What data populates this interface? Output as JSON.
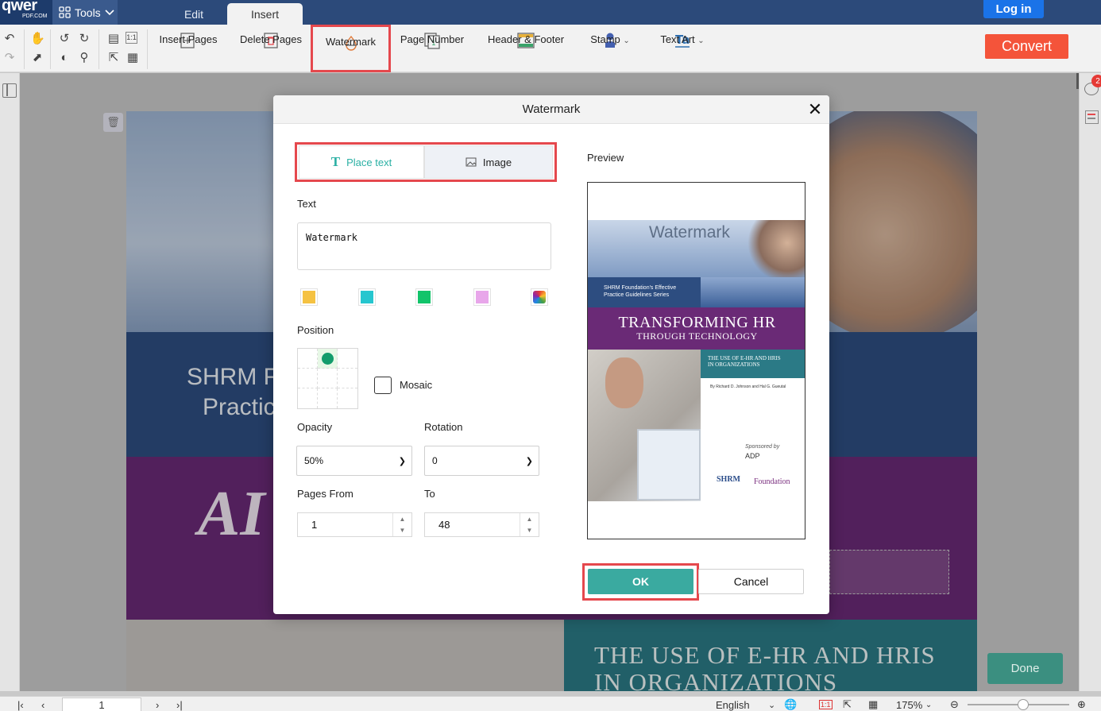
{
  "header": {
    "logo_main": "qwer",
    "logo_sub": "PDF.COM",
    "tools_label": "Tools",
    "tabs": [
      {
        "label": "Edit"
      },
      {
        "label": "Insert"
      }
    ],
    "login_label": "Log in"
  },
  "toolbar": {
    "tools": [
      {
        "label": "Insert Pages",
        "icon": "insert-pages-icon"
      },
      {
        "label": "Delete Pages",
        "icon": "delete-pages-icon"
      },
      {
        "label": "Watermark",
        "icon": "watermark-icon"
      },
      {
        "label": "Page Number",
        "icon": "page-number-icon"
      },
      {
        "label": "Header & Footer",
        "icon": "header-footer-icon"
      },
      {
        "label": "Stamp",
        "icon": "stamp-icon"
      },
      {
        "label": "Text Art",
        "icon": "text-art-icon"
      }
    ],
    "convert_label": "Convert"
  },
  "document": {
    "line1": "SHRM F",
    "line2": "Practic",
    "line3": "AI",
    "line4a": "THE USE OF E-HR AND HRIS",
    "line4b": "IN ORGANIZATIONS"
  },
  "notification_count": "2",
  "done_label": "Done",
  "statusbar": {
    "page": "1",
    "language": "English",
    "zoom": "175%",
    "zoom_level_percent": 50
  },
  "dialog": {
    "title": "Watermark",
    "tabs": {
      "text": "Place text",
      "image": "Image"
    },
    "text_label": "Text",
    "text_value": "Watermark",
    "colors": [
      "#f5c242",
      "#26c6cf",
      "#12c46a",
      "#e8a6ea"
    ],
    "position_label": "Position",
    "position_selected": 1,
    "mosaic_label": "Mosaic",
    "opacity_label": "Opacity",
    "opacity_value": "50%",
    "rotation_label": "Rotation",
    "rotation_value": "0",
    "pages_from_label": "Pages From",
    "pages_from_value": "1",
    "to_label": "To",
    "to_value": "48",
    "preview_label": "Preview",
    "preview": {
      "watermark": "Watermark",
      "series_line1": "SHRM Foundation's Effective",
      "series_line2": "Practice Guidelines Series",
      "title_a": "TRANSFORMING HR",
      "title_b": "THROUGH TECHNOLOGY",
      "sub_a": "THE USE OF E-HR AND HRIS",
      "sub_b": "IN ORGANIZATIONS",
      "byline": "By Richard D. Johnson and Hal G. Gueutal",
      "sponsored": "Sponsored by",
      "sponsor": "ADP",
      "logo1": "SHRM",
      "logo2": "Foundation"
    },
    "ok_label": "OK",
    "cancel_label": "Cancel"
  }
}
